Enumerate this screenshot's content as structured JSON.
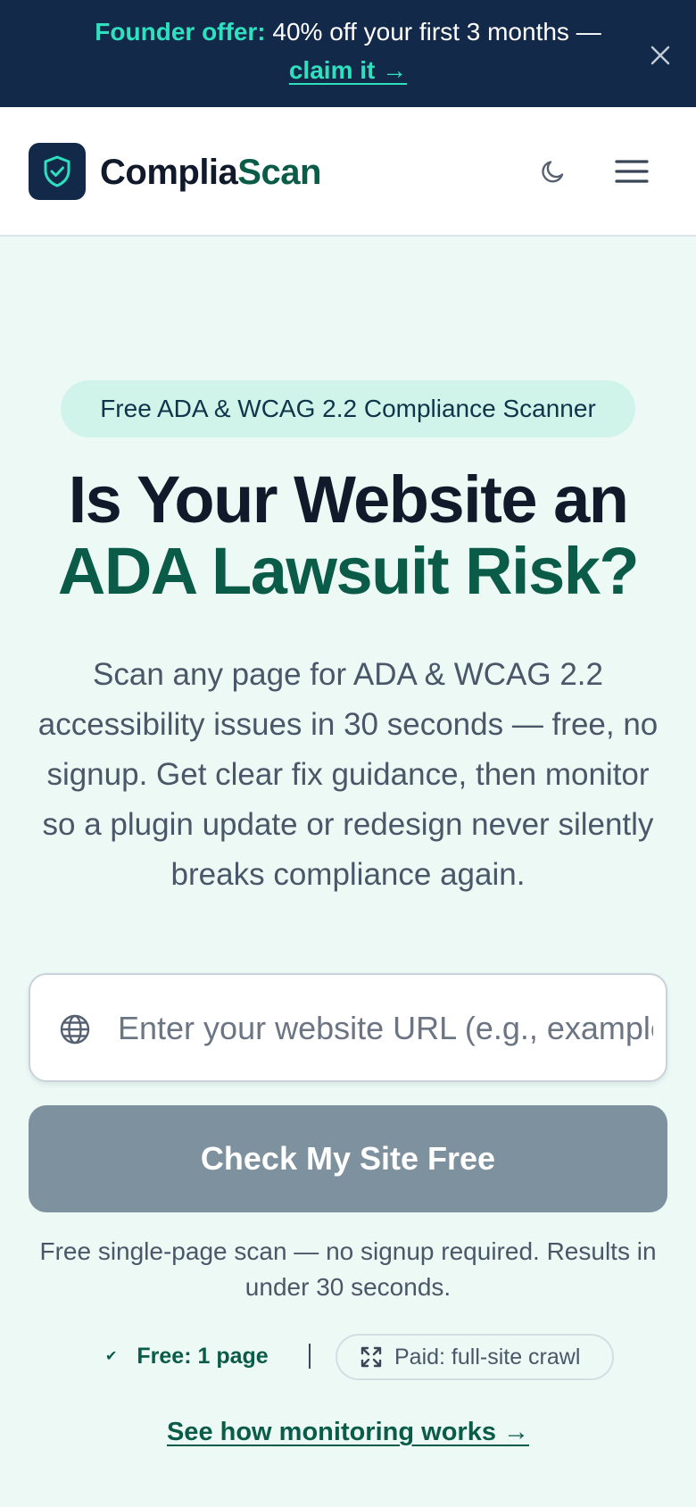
{
  "banner": {
    "highlight": "Founder offer:",
    "text": "40% off your first 3 months —",
    "link": "claim it →",
    "close_icon": "close-icon"
  },
  "header": {
    "logo_icon": "shield-check-icon",
    "brand_part1": "Complia",
    "brand_part2": "Scan",
    "theme_icon": "moon-icon",
    "menu_icon": "hamburger-menu-icon"
  },
  "hero": {
    "badge": "Free ADA & WCAG 2.2 Compliance Scanner",
    "headline_line1": "Is Your Website an",
    "headline_line2": "ADA Lawsuit Risk?",
    "subtext": "Scan any page for ADA & WCAG 2.2 accessibility issues in 30 seconds — free, no signup. Get clear fix guidance, then monitor so a plugin update or redesign never silently breaks compliance again."
  },
  "scan_form": {
    "url_icon": "globe-icon",
    "url_value": "",
    "url_placeholder": "Enter your website URL (e.g., example.com)",
    "submit_label": "Check My Site Free",
    "note": "Free single-page scan — no signup required. Results in under 30 seconds."
  },
  "tiers": {
    "free_icon": "check-icon",
    "free_label": "Free: 1 page",
    "paid_icon": "expand-icon",
    "paid_label": "Paid: full-site crawl"
  },
  "monitor_link": "See how monitoring works →",
  "colors": {
    "banner_bg": "#13294a",
    "accent_teal": "#2ee0bd",
    "brand_green": "#0a5c48",
    "page_bg": "#ecf9f5",
    "cta_bg": "#7e919e"
  }
}
